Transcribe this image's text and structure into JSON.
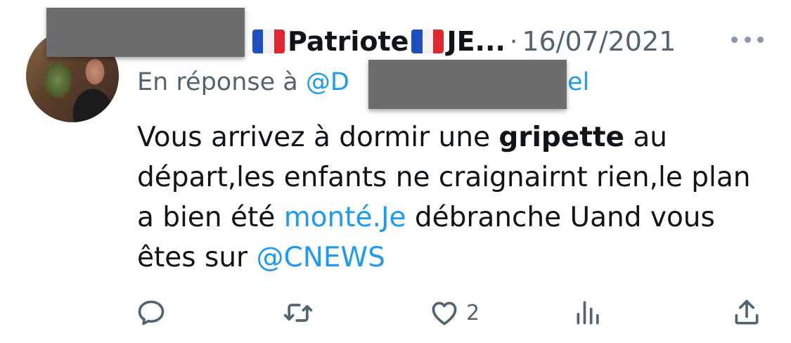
{
  "tweet": {
    "display_name": "Patriote",
    "display_name_suffix": "JE...",
    "separator": "·",
    "date": "16/07/2021",
    "reply_prefix": "En réponse à",
    "reply_handle_start": "@D",
    "reply_handle_end": "el",
    "text": {
      "p1": "Vous arrivez à dormir une ",
      "bold": "gripette",
      "p2": " au départ,les enfants ne craignairnt rien,le plan a bien été ",
      "link1": "monté.Je",
      "p3": " débranche Uand vous êtes sur ",
      "link2": "@CNEWS"
    }
  },
  "actions": {
    "like_count": "2",
    "icons": [
      "reply-icon",
      "retweet-icon",
      "like-icon",
      "views-icon",
      "share-icon"
    ]
  },
  "colors": {
    "link": "#1d9bf0",
    "secondary_text": "#536471",
    "primary_text": "#0f1419",
    "redaction": "#6d6d6f"
  }
}
